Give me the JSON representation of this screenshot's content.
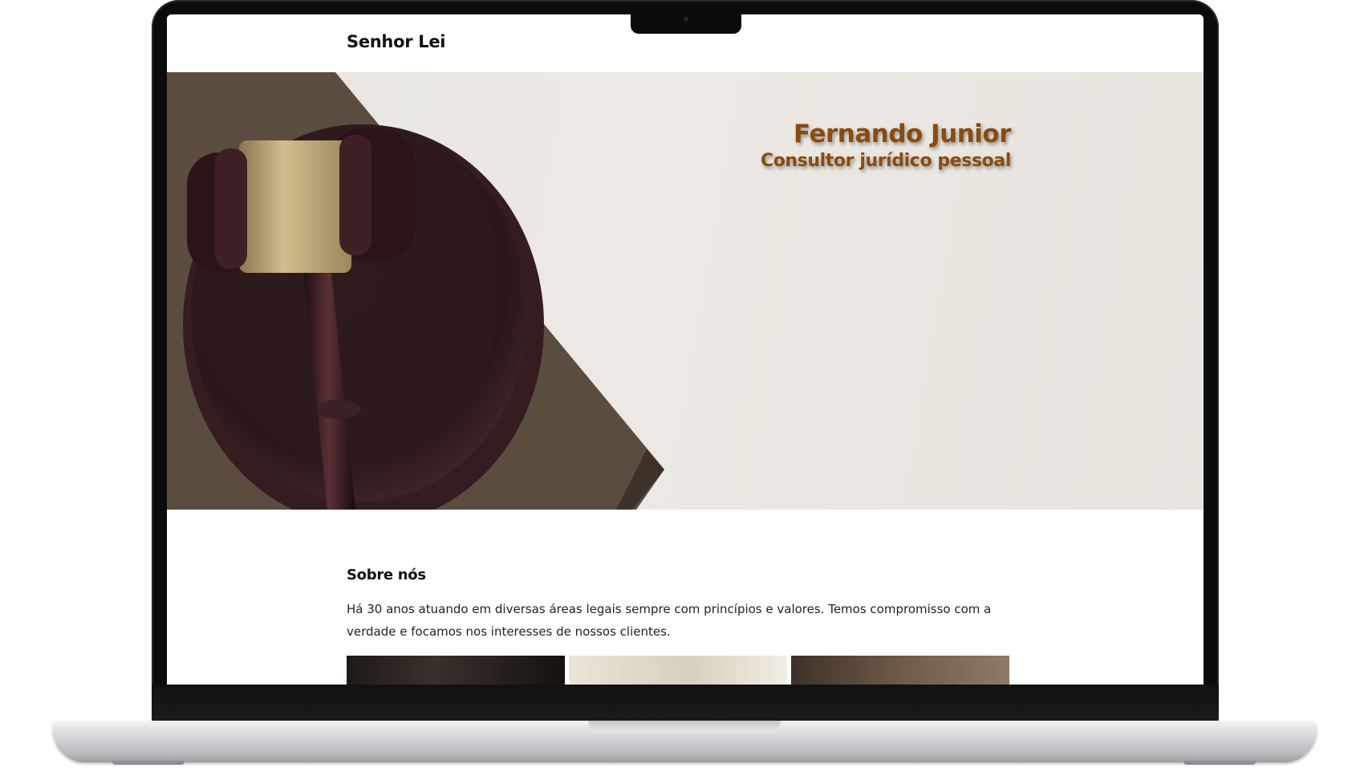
{
  "site": {
    "brand": "Senhor Lei"
  },
  "hero": {
    "name": "Fernando Junior",
    "role": "Consultor jurídico pessoal",
    "image": "gavel-on-book"
  },
  "about": {
    "title": "Sobre nós",
    "text": "Há 30 anos atuando em diversas áreas legais sempre com princípios e valores. Temos compromisso com a verdade e focamos nos interesses de nossos clientes."
  },
  "gallery": {
    "images": [
      "man-in-suit",
      "open-book",
      "bearded-man"
    ]
  },
  "colors": {
    "accent": "#8a4b0f",
    "hero_bg": "#ebe8e3",
    "frame": "#0b0b0c"
  }
}
